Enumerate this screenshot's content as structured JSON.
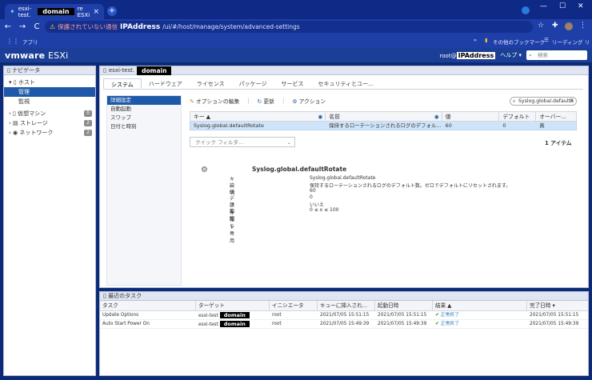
{
  "browser": {
    "tab_prefix": "esxi-test.",
    "tab_domain": "domain",
    "tab_suffix": "re ESXi",
    "tab_close": "×",
    "new_tab": "+",
    "win_min": "—",
    "win_max": "☐",
    "win_close": "✕",
    "back": "←",
    "forward": "→",
    "reload": "C",
    "url_warn_icon": "⚠",
    "url_warning": "保護されていない通信",
    "url_ip": "IPAddress",
    "url_path": "/ui/#/host/manage/system/advanced-settings",
    "apps_label": "アプリ",
    "bookmarks_more": "»",
    "other_bookmarks": "その他のブックマーク",
    "reading_list": "リーディング リスト"
  },
  "esxi_header": {
    "logo_vm": "vmware",
    "logo_esxi": " ESXi",
    "user_prefix": "root@",
    "user_ip": "IPAddress",
    "help": "ヘルプ ▾",
    "search_placeholder": "検索",
    "search_icon": "⌕"
  },
  "navigator": {
    "title": "ナビゲータ",
    "host": "ホスト",
    "manage": "管理",
    "monitor": "監視",
    "vms": "仮想マシン",
    "vms_count": "0",
    "storage": "ストレージ",
    "storage_count": "2",
    "network": "ネットワーク",
    "network_count": "2"
  },
  "main": {
    "host_prefix": "esxi-test.",
    "host_domain": "domain",
    "tabs": [
      "システム",
      "ハードウェア",
      "ライセンス",
      "パッケージ",
      "サービス",
      "セキュリティとユー..."
    ],
    "subnav": [
      "詳細設定",
      "自動起動",
      "スワップ",
      "日付と時刻"
    ],
    "toolbar": {
      "edit_options": "オプションの編集",
      "refresh": "更新",
      "actions": "アクション"
    },
    "filter_value": "Syslog.global.defaultR",
    "grid_headers": [
      "キー ▲",
      "名前",
      "値",
      "デフォルト",
      "オーバー..."
    ],
    "grid_row": [
      "Syslog.global.defaultRotate",
      "保持するローテーションされるログのデフォル...",
      "60",
      "0",
      "真"
    ],
    "quick_filter": "クイック フィルタ...",
    "item_count": "1 アイテム"
  },
  "detail": {
    "title": "Syslog.global.defaultRotate",
    "labels": [
      "キー",
      "説明",
      "値",
      "デフォルト",
      "読み取り専用",
      "範囲"
    ],
    "values": [
      "Syslog.global.defaultRotate",
      "保持するローテーションされるログのデフォルト数。ゼロでデフォルトにリセットされます。",
      "60",
      "0",
      "いいえ",
      "0 ≤ x ≤ 100"
    ]
  },
  "tasks": {
    "title": "最近のタスク",
    "headers": [
      "タスク",
      "ターゲット",
      "イニシエータ",
      "キューに挿入され...",
      "起動日時",
      "結果 ▲",
      "完了日時 ▾"
    ],
    "rows": [
      {
        "task": "Update Options",
        "target_prefix": "esxi-test",
        "target_domain": "domain",
        "initiator": "root",
        "queued": "2021/07/05 15:51:15",
        "started": "2021/07/05 15:51:15",
        "result": "正常終了",
        "completed": "2021/07/05 15:51:15"
      },
      {
        "task": "Auto Start Power On",
        "target_prefix": "esxi-test",
        "target_domain": "domain",
        "initiator": "root",
        "queued": "2021/07/05 15:49:39",
        "started": "2021/07/05 15:49:39",
        "result": "正常終了",
        "completed": "2021/07/05 15:49:39"
      }
    ]
  }
}
